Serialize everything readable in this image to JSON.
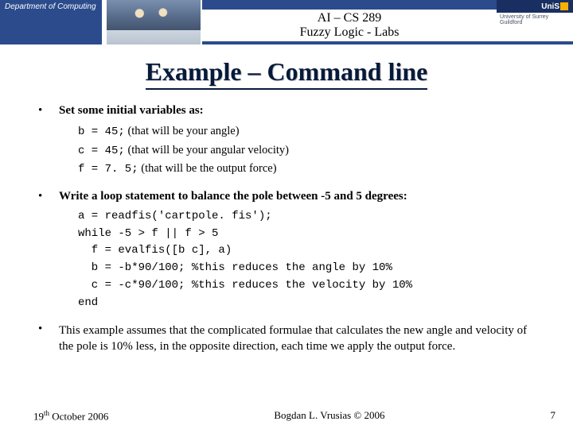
{
  "header": {
    "department": "Department of Computing",
    "line1": "AI – CS 289",
    "line2": "Fuzzy Logic - Labs",
    "logo_text": "UniS",
    "logo_sub": "University of Surrey Guildford"
  },
  "title": "Example – Command line",
  "bullets": [
    {
      "lead": "Set some initial variables as:",
      "code": [
        {
          "mono": "b = 45;",
          "serif": " (that will be your angle)"
        },
        {
          "mono": "c = 45;",
          "serif": " (that will be your angular velocity)"
        },
        {
          "mono": "f = 7. 5;",
          "serif": " (that will be the output force)"
        }
      ]
    },
    {
      "lead": "Write a loop statement to balance the pole between -5 and 5 degrees:",
      "code": [
        {
          "mono": "a = readfis('cartpole. fis');"
        },
        {
          "mono": "while -5 > f || f > 5"
        },
        {
          "mono": "  f = evalfis([b c], a)"
        },
        {
          "mono": "  b = -b*90/100; %this reduces the angle by 10%"
        },
        {
          "mono": "  c = -c*90/100; %this reduces the velocity by 10%"
        },
        {
          "mono": "end"
        }
      ]
    },
    {
      "para": "This example assumes that the complicated formulae that calculates the new angle and velocity of the pole is 10% less, in the opposite direction, each time we apply the output force."
    }
  ],
  "footer": {
    "date_day": "19",
    "date_sup": "th",
    "date_rest": " October 2006",
    "center": "Bogdan L. Vrusias © 2006",
    "page": "7"
  }
}
